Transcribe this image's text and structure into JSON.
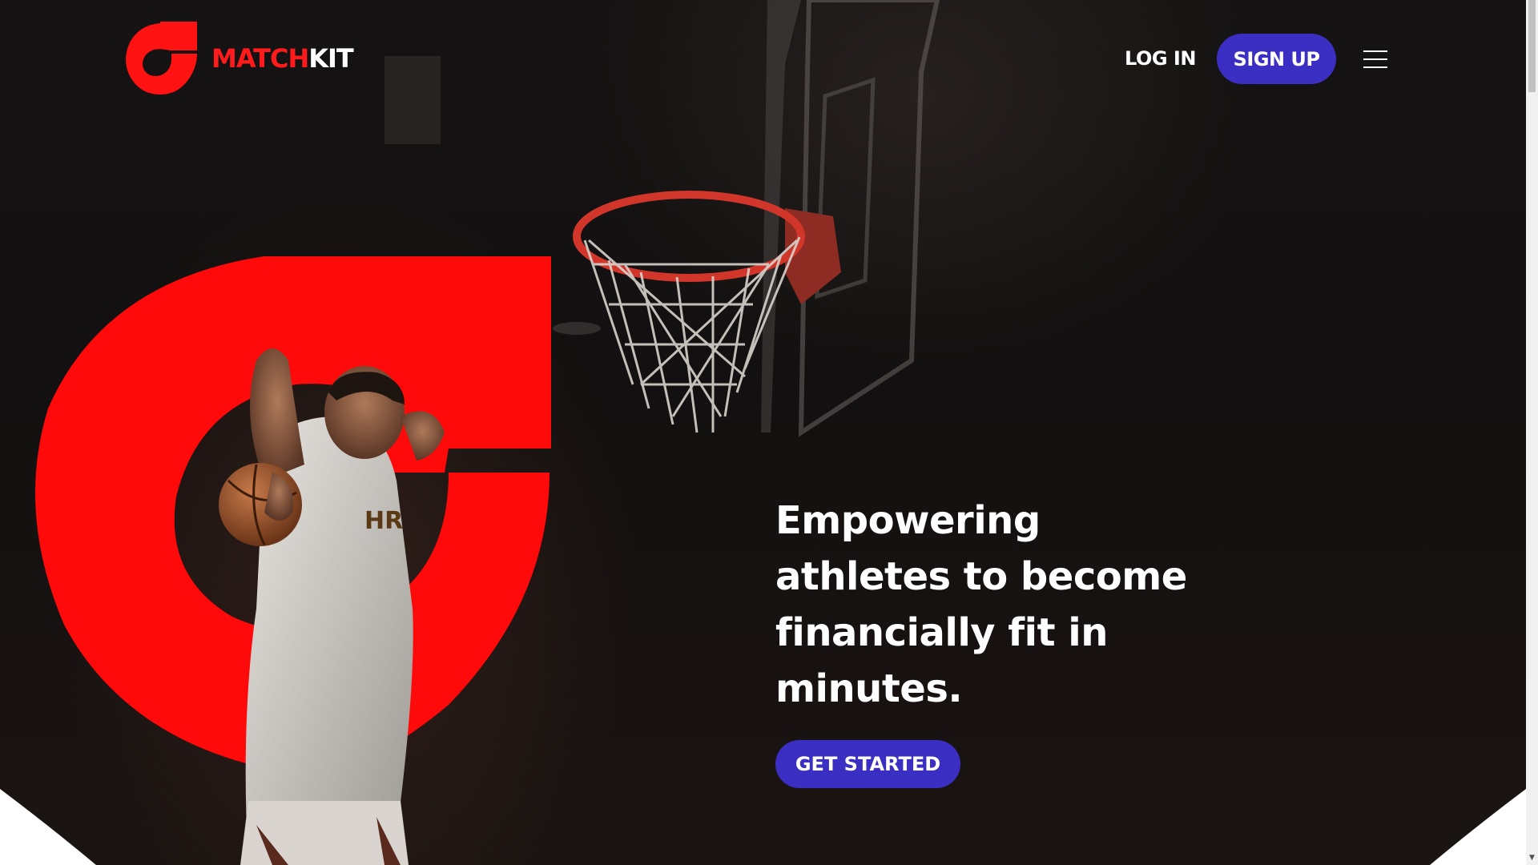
{
  "brand": {
    "name_part1": "MATCH",
    "name_part2": "KIT",
    "red_color": "#ff1b1b",
    "logo_icon": "matchkit-logo-icon"
  },
  "nav": {
    "login_label": "LOG IN",
    "signup_label": "SIGN UP",
    "menu_icon": "hamburger-menu-icon"
  },
  "hero": {
    "headline": "Empowering athletes to become financially fit in minutes.",
    "cta_label": "GET STARTED",
    "image": "basketball-player-dunking-photo",
    "accent_color": "#3a2fc2"
  },
  "scrollbar": {
    "down_arrow_icon": "scroll-down-arrow-icon"
  }
}
